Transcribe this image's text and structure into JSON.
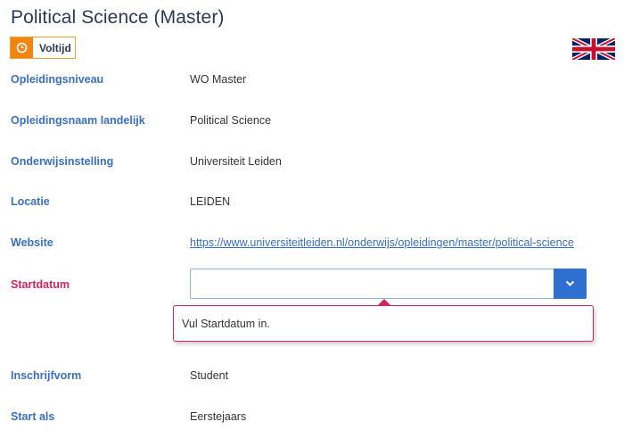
{
  "header": {
    "title": "Political Science (Master)",
    "badge_label": "Voltijd",
    "badge_icon": "clock-icon",
    "language_flag": "uk-flag-icon"
  },
  "fields": {
    "opleidingsniveau": {
      "label": "Opleidingsniveau",
      "value": "WO Master"
    },
    "opleidingsnaam": {
      "label": "Opleidingsnaam landelijk",
      "value": "Political Science"
    },
    "onderwijsinstelling": {
      "label": "Onderwijsinstelling",
      "value": "Universiteit Leiden"
    },
    "locatie": {
      "label": "Locatie",
      "value": "LEIDEN"
    },
    "website": {
      "label": "Website",
      "value": "https://www.universiteitleiden.nl/onderwijs/opleidingen/master/political-science"
    },
    "startdatum": {
      "label": "Startdatum",
      "value": "",
      "error": "Vul Startdatum in."
    },
    "inschrijfvorm": {
      "label": "Inschrijfvorm",
      "value": "Student"
    },
    "start_als": {
      "label": "Start als",
      "value": "Eerstejaars"
    }
  },
  "colors": {
    "label": "#3a6fc4",
    "error": "#d4245c",
    "accent": "#2f6fd0",
    "badge": "#f0860f"
  }
}
